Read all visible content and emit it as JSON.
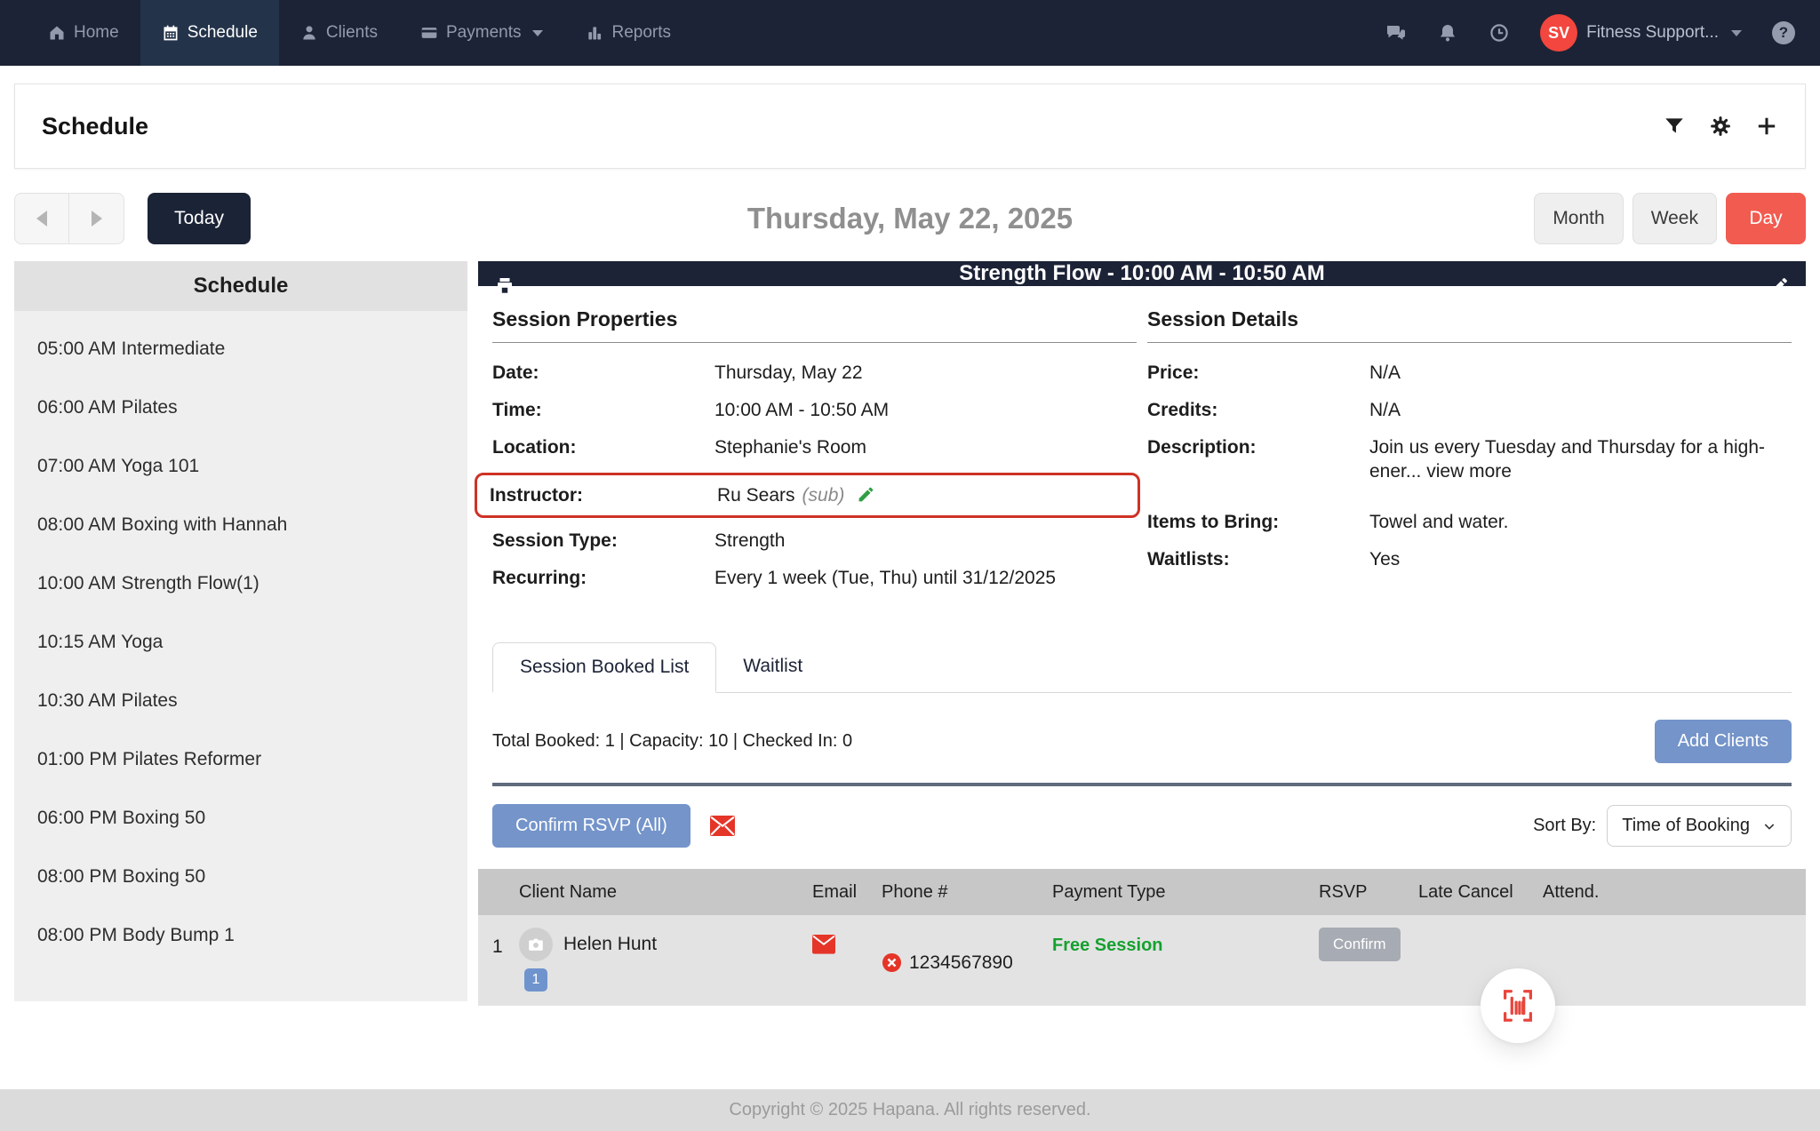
{
  "colors": {
    "navbar_bg": "#1c2336",
    "active_nav_bg": "#233349",
    "avatar_red": "#f2463e",
    "day_active_red": "#f15b50",
    "dark_button": "#1b2337",
    "primary_blue": "#7494ca",
    "badge_blue": "#6f94cd",
    "success_green": "#16a12f",
    "alert_red": "#e53528",
    "highlight_border": "#ce3226",
    "edit_green": "#2f9e44"
  },
  "navbar": {
    "items": [
      {
        "label": "Home",
        "icon": "home-icon"
      },
      {
        "label": "Schedule",
        "icon": "calendar-icon",
        "active": true
      },
      {
        "label": "Clients",
        "icon": "clients-icon"
      },
      {
        "label": "Payments",
        "icon": "payments-icon",
        "caret": true
      },
      {
        "label": "Reports",
        "icon": "reports-icon"
      }
    ],
    "right_icons": [
      "chat-icon",
      "bell-icon",
      "clock-icon",
      "help-icon"
    ],
    "avatar_initials": "SV",
    "account_label": "Fitness Support..."
  },
  "page_header": {
    "title": "Schedule",
    "icons": [
      "filter-icon",
      "settings-icon",
      "add-icon"
    ]
  },
  "toolbar": {
    "today_label": "Today",
    "date_title": "Thursday, May 22, 2025",
    "views": [
      "Month",
      "Week",
      "Day"
    ],
    "active_view": "Day"
  },
  "sidebar": {
    "title": "Schedule",
    "items": [
      "05:00 AM Intermediate",
      "06:00 AM Pilates",
      "07:00 AM Yoga 101",
      "08:00 AM Boxing with Hannah",
      "10:00 AM Strength Flow(1)",
      "10:15 AM Yoga",
      "10:30 AM Pilates",
      "01:00 PM Pilates Reformer",
      "06:00 PM Boxing 50",
      "08:00 PM Boxing 50",
      "08:00 PM Body Bump 1"
    ]
  },
  "panel": {
    "header_title": "Strength Flow - 10:00 AM - 10:50 AM",
    "properties": {
      "heading": "Session Properties",
      "rows": [
        {
          "label": "Date:",
          "value": "Thursday, May 22"
        },
        {
          "label": "Time:",
          "value": "10:00 AM - 10:50 AM"
        },
        {
          "label": "Location:",
          "value": "Stephanie's Room"
        },
        {
          "label": "Instructor:",
          "value": "Ru Sears",
          "suffix": "(sub)",
          "highlighted": true,
          "edit_icon": "pencil-icon"
        },
        {
          "label": "Session Type:",
          "value": "Strength"
        },
        {
          "label": "Recurring:",
          "value": "Every 1 week (Tue, Thu) until 31/12/2025"
        }
      ]
    },
    "details": {
      "heading": "Session Details",
      "rows": [
        {
          "label": "Price:",
          "value": "N/A"
        },
        {
          "label": "Credits:",
          "value": "N/A"
        },
        {
          "label": "Description:",
          "value": "Join us every Tuesday and Thursday for a high-ener...",
          "link": "view more"
        },
        {
          "label": "Items to Bring:",
          "value": "Towel and water."
        },
        {
          "label": "Waitlists:",
          "value": "Yes"
        }
      ]
    },
    "tabs": [
      {
        "label": "Session Booked List",
        "active": true
      },
      {
        "label": "Waitlist",
        "active": false
      }
    ],
    "summary": "Total Booked: 1 | Capacity: 10 | Checked In: 0",
    "add_clients_label": "Add Clients",
    "confirm_rsvp_label": "Confirm RSVP (All)",
    "sort_by_label": "Sort By:",
    "sort_by_value": "Time of Booking",
    "table": {
      "headers": [
        "Client Name",
        "Email",
        "Phone #",
        "Payment Type",
        "RSVP",
        "Late Cancel",
        "Attend."
      ],
      "rows": [
        {
          "index": "1",
          "name": "Helen Hunt",
          "phone": "1234567890",
          "payment_type": "Free Session",
          "rsvp_label": "Confirm",
          "badge": "1"
        }
      ]
    }
  },
  "footer": {
    "copyright": "Copyright © 2025 Hapana. All rights reserved."
  }
}
